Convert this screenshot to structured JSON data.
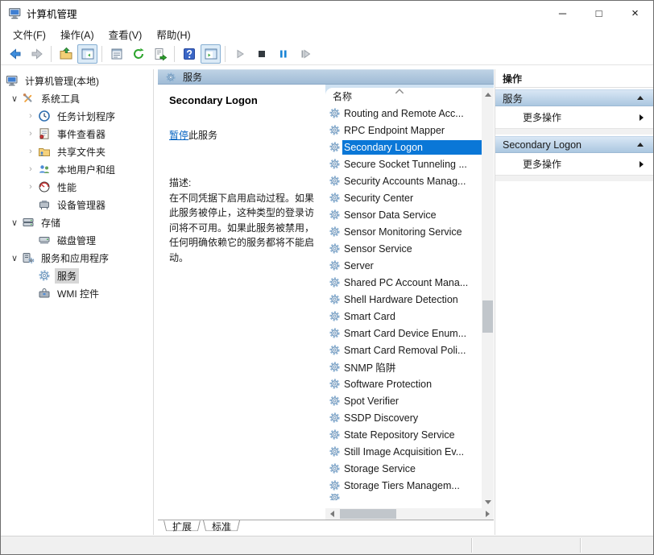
{
  "window": {
    "title": "计算机管理",
    "minimize_glyph": "─",
    "maximize_glyph": "□",
    "close_glyph": "×"
  },
  "menu": {
    "items": [
      "文件(F)",
      "操作(A)",
      "查看(V)",
      "帮助(H)"
    ]
  },
  "toolbar": {
    "items": [
      {
        "icon": "back-icon",
        "interactable": "true"
      },
      {
        "icon": "forward-icon",
        "disabled": true,
        "interactable": "true"
      },
      {
        "sep": true,
        "interactable": "false"
      },
      {
        "icon": "up-folder-icon",
        "interactable": "true"
      },
      {
        "icon": "console-tree-toggle-icon",
        "pressed": true,
        "interactable": "true"
      },
      {
        "sep": true,
        "interactable": "false"
      },
      {
        "icon": "properties-icon",
        "interactable": "true"
      },
      {
        "icon": "refresh-icon",
        "interactable": "true"
      },
      {
        "icon": "export-list-icon",
        "interactable": "true"
      },
      {
        "sep": true,
        "interactable": "false"
      },
      {
        "icon": "help-icon",
        "interactable": "true"
      },
      {
        "icon": "action-pane-toggle-icon",
        "pressed": true,
        "interactable": "true"
      },
      {
        "sep": true,
        "interactable": "false"
      },
      {
        "icon": "start-service-icon",
        "disabled": true,
        "interactable": "true"
      },
      {
        "icon": "stop-service-icon",
        "interactable": "true"
      },
      {
        "icon": "pause-service-icon",
        "interactable": "true"
      },
      {
        "icon": "restart-service-icon",
        "interactable": "true"
      }
    ]
  },
  "tree": {
    "items": [
      {
        "label": "计算机管理(本地)",
        "icon": "computer-icon",
        "chevron": "",
        "root": true,
        "level": 0
      },
      {
        "label": "系统工具",
        "icon": "tools-icon",
        "chevron": "∨",
        "expanded": true,
        "level": 1
      },
      {
        "label": "任务计划程序",
        "icon": "clock-icon",
        "chevron": "›",
        "level": 2
      },
      {
        "label": "事件查看器",
        "icon": "event-log-icon",
        "chevron": "›",
        "level": 2
      },
      {
        "label": "共享文件夹",
        "icon": "shared-folder-icon",
        "chevron": "›",
        "level": 2
      },
      {
        "label": "本地用户和组",
        "icon": "users-icon",
        "chevron": "›",
        "level": 2
      },
      {
        "label": "性能",
        "icon": "performance-icon",
        "chevron": "›",
        "level": 2
      },
      {
        "label": "设备管理器",
        "icon": "device-icon",
        "chevron": "",
        "level": 2
      },
      {
        "label": "存储",
        "icon": "storage-icon",
        "chevron": "∨",
        "expanded": true,
        "level": 1
      },
      {
        "label": "磁盘管理",
        "icon": "disk-icon",
        "chevron": "",
        "level": 2
      },
      {
        "label": "服务和应用程序",
        "icon": "server-gear-icon",
        "chevron": "∨",
        "expanded": true,
        "level": 1
      },
      {
        "label": "服务",
        "icon": "gear-icon",
        "chevron": "",
        "level": 2,
        "selected": true
      },
      {
        "label": "WMI 控件",
        "icon": "wmi-icon",
        "chevron": "",
        "level": 2
      }
    ]
  },
  "middle": {
    "header": "服务",
    "info": {
      "service_name": "Secondary Logon",
      "pause_link": "暂停",
      "pause_suffix": "此服务",
      "desc_label": "描述:",
      "description": "在不同凭据下启用启动过程。如果此服务被停止，这种类型的登录访问将不可用。如果此服务被禁用，任何明确依赖它的服务都将不能启动。"
    },
    "list": {
      "column_header": "名称",
      "items": [
        {
          "icon": "gear-icon",
          "label": "Routing and Remote Acc..."
        },
        {
          "icon": "gear-icon",
          "label": "RPC Endpoint Mapper"
        },
        {
          "icon": "gear-icon",
          "label": "Secondary Logon",
          "selected": true
        },
        {
          "icon": "gear-icon",
          "label": "Secure Socket Tunneling ..."
        },
        {
          "icon": "gear-icon",
          "label": "Security Accounts Manag..."
        },
        {
          "icon": "gear-icon",
          "label": "Security Center"
        },
        {
          "icon": "gear-icon",
          "label": "Sensor Data Service"
        },
        {
          "icon": "gear-icon",
          "label": "Sensor Monitoring Service"
        },
        {
          "icon": "gear-icon",
          "label": "Sensor Service"
        },
        {
          "icon": "gear-icon",
          "label": "Server"
        },
        {
          "icon": "gear-icon",
          "label": "Shared PC Account Mana..."
        },
        {
          "icon": "gear-icon",
          "label": "Shell Hardware Detection"
        },
        {
          "icon": "gear-icon",
          "label": "Smart Card"
        },
        {
          "icon": "gear-icon",
          "label": "Smart Card Device Enum..."
        },
        {
          "icon": "gear-icon",
          "label": "Smart Card Removal Poli..."
        },
        {
          "icon": "gear-icon",
          "label": "SNMP 陷阱"
        },
        {
          "icon": "gear-icon",
          "label": "Software Protection"
        },
        {
          "icon": "gear-icon",
          "label": "Spot Verifier"
        },
        {
          "icon": "gear-icon",
          "label": "SSDP Discovery"
        },
        {
          "icon": "gear-icon",
          "label": "State Repository Service"
        },
        {
          "icon": "gear-icon",
          "label": "Still Image Acquisition Ev..."
        },
        {
          "icon": "gear-icon",
          "label": "Storage Service"
        },
        {
          "icon": "gear-icon",
          "label": "Storage Tiers Managem..."
        },
        {
          "icon": "gear-icon",
          "label": "",
          "partial": true
        }
      ]
    },
    "tabs": {
      "items": [
        {
          "label": "扩展",
          "active": true
        },
        {
          "label": "标准"
        }
      ]
    }
  },
  "actions": {
    "title": "操作",
    "sections": [
      {
        "header": "服务",
        "more_label": "更多操作"
      },
      {
        "header": "Secondary Logon",
        "more_label": "更多操作"
      }
    ]
  },
  "colors": {
    "selection_blue": "#0a77d7",
    "link_blue": "#0563c1",
    "pane_header_blue": "#a9c3da",
    "tree_selection_gray": "#d6d6d6"
  }
}
